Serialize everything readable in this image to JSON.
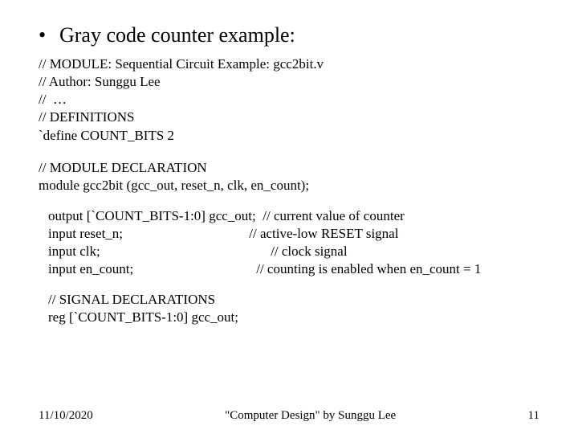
{
  "title": "Gray code counter example:",
  "code": {
    "block1": "// MODULE: Sequential Circuit Example: gcc2bit.v\n// Author: Sunggu Lee\n//  …\n// DEFINITIONS\n`define COUNT_BITS 2",
    "block2": "// MODULE DECLARATION\nmodule gcc2bit (gcc_out, reset_n, clk, en_count);",
    "block3": "output [`COUNT_BITS-1:0] gcc_out;  // current value of counter\ninput reset_n;                                     // active-low RESET signal\ninput clk;                                                  // clock signal\ninput en_count;                                    // counting is enabled when en_count = 1",
    "block4": "// SIGNAL DECLARATIONS\nreg [`COUNT_BITS-1:0] gcc_out;"
  },
  "footer": {
    "date": "11/10/2020",
    "center": "\"Computer Design\" by Sunggu Lee",
    "page": "11"
  }
}
